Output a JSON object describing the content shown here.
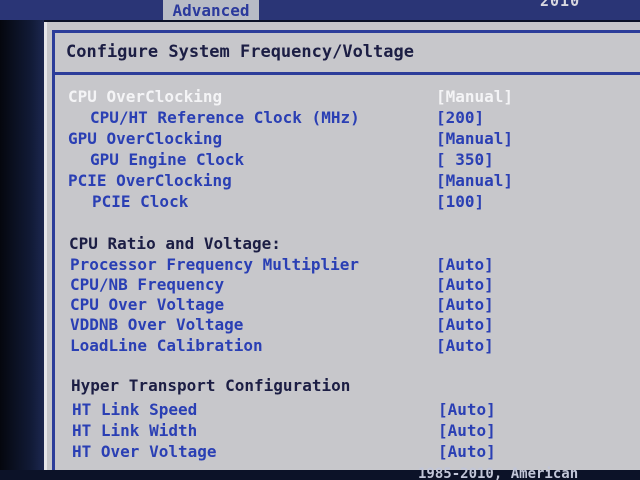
{
  "top_bar": {
    "active_tab": "Advanced",
    "right_text": "2010"
  },
  "panel": {
    "title": "Configure System Frequency/Voltage"
  },
  "rows": [
    {
      "label": "CPU OverClocking",
      "value": "[Manual]",
      "selected": true
    },
    {
      "label": "CPU/HT Reference Clock (MHz)",
      "value": "[200]",
      "selected": false
    },
    {
      "label": "GPU OverClocking",
      "value": "[Manual]",
      "selected": false
    },
    {
      "label": "GPU Engine Clock",
      "value": "[ 350]",
      "selected": false
    },
    {
      "label": "PCIE OverClocking",
      "value": "[Manual]",
      "selected": false
    },
    {
      "label": "PCIE Clock",
      "value": "[100]",
      "selected": false
    },
    {
      "section": "CPU Ratio and Voltage:"
    },
    {
      "label": "Processor Frequency Multiplier",
      "value": "[Auto]",
      "selected": false
    },
    {
      "label": "CPU/NB Frequency",
      "value": "[Auto]",
      "selected": false
    },
    {
      "label": "CPU Over Voltage",
      "value": "[Auto]",
      "selected": false
    },
    {
      "label": "VDDNB Over Voltage",
      "value": "[Auto]",
      "selected": false
    },
    {
      "label": "LoadLine Calibration",
      "value": "[Auto]",
      "selected": false
    },
    {
      "section": "Hyper Transport Configuration"
    },
    {
      "label": "HT Link Speed",
      "value": "[Auto]",
      "selected": false
    },
    {
      "label": "HT Link Width",
      "value": "[Auto]",
      "selected": false
    },
    {
      "label": "HT Over Voltage",
      "value": "[Auto]",
      "selected": false
    }
  ],
  "footer": {
    "copyright": "1985-2010, American"
  },
  "colors": {
    "selected_text": "#f4f4f6",
    "item_text": "#2a3fb4",
    "header_text": "#1c1e44",
    "panel_bg": "#c7c7cb",
    "border_blue": "#2c3d9a"
  }
}
